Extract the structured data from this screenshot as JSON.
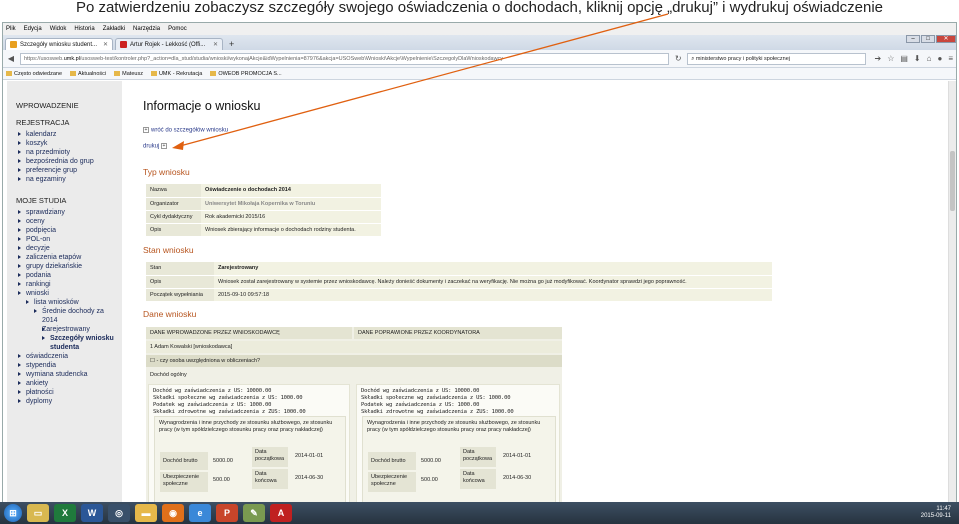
{
  "caption": "Po zatwierdzeniu zobaczysz szczegóły swojego oświadczenia o dochodach, kliknij opcję „drukuj” i wydrukuj oświadczenie",
  "menu": [
    "Plik",
    "Edycja",
    "Widok",
    "Historia",
    "Zakładki",
    "Narzędzia",
    "Pomoc"
  ],
  "tabs": [
    {
      "label": "Szczegóły wniosku student...",
      "color": "#e8a020",
      "active": true
    },
    {
      "label": "Artur Rojek - Lekkość (Offi...",
      "color": "#cc2020",
      "active": false
    }
  ],
  "newtab": "+",
  "url": {
    "prefix": "https://usosweb.",
    "host": "umk.pl",
    "rest": "/usosweb-test/kontroler.php?_action=dla_stud/studia/wnioski/wykonajAkcje&idWypelnienia=87976&akcja=USOSweb\\Wnioski\\Akcje\\Wypelnienie\\SzczegolyDlaWnioskodawcy"
  },
  "search": "ministerstwo pracy i polityki społecznej",
  "bookmarks": [
    "Często odwiedzane",
    "Aktualności",
    "Mateusz",
    "UMK - Rekrutacja",
    "OWEOB PROMOCJA S..."
  ],
  "sidebar": {
    "head1": "WPROWADZENIE",
    "head2": "REJESTRACJA",
    "reg": [
      "kalendarz",
      "koszyk",
      "na przedmioty",
      "bezpośrednia do grup",
      "preferencje grup",
      "na egzaminy"
    ],
    "head3": "MOJE STUDIA",
    "studia": [
      "sprawdziany",
      "oceny",
      "podpięcia",
      "POL-on",
      "decyzje",
      "zaliczenia etapów",
      "grupy dziekańskie",
      "podania",
      "rankingi",
      "wnioski"
    ],
    "wnioski_sub": "lista wniosków",
    "srednie": "Średnie dochody za",
    "year": "2014",
    "zarej": "Zarejestrowany",
    "szczegoly": "Szczegóły wniosku",
    "studenta": "studenta",
    "rest": [
      "oświadczenia",
      "stypendia",
      "wymiana studencka",
      "ankiety",
      "płatności",
      "dyplomy"
    ]
  },
  "main": {
    "title": "Informacje o wniosku",
    "back": "wróć do szczegółów wniosku",
    "print": "drukuj",
    "typ_header": "Typ wniosku",
    "typ_rows": [
      {
        "k": "Nazwa",
        "v": "Oświadczenie o dochodach 2014"
      },
      {
        "k": "Organizator",
        "v": "Uniwersytet Mikołaja Kopernika w Toruniu"
      },
      {
        "k": "Cykl dydaktyczny",
        "v": "Rok akademicki 2015/16"
      },
      {
        "k": "Opis",
        "v": "Wniosek zbierający informacje o dochodach rodziny studenta."
      }
    ],
    "stan_header": "Stan wniosku",
    "stan_rows": [
      {
        "k": "Stan",
        "v": "Zarejestrowany"
      },
      {
        "k": "Opis",
        "v": "Wniosek został zarejestrowany w systemie przez wnioskodawcę. Należy donieść dokumenty i zaczekać na weryfikację. Nie można go już modyfikować. Koordynator sprawdzi jego poprawność."
      },
      {
        "k": "Początek wypełniania",
        "v": "2015-09-10 09:57:18"
      }
    ],
    "dane_header": "Dane wniosku",
    "col_left": "DANE WPROWADZONE PRZEZ WNIOSKODAWCĘ",
    "col_right": "DANE POPRAWIONE PRZEZ KOORDYNATORA",
    "person": "1 Adam Kowalski [wnioskodawca]",
    "question": "- czy osoba uwzględniona w obliczeniach?",
    "dochod_ogolny": "Dochód ogólny",
    "lines": [
      "Dochód wg zaświadczenia z US: 10000.00",
      "Składki społeczne wg zaświadczenia z US: 1000.00",
      "Podatek wg zaświadczenia z US: 1000.00",
      "Składki zdrowotne wg zaświadczenia z ZUS: 1000.00"
    ],
    "wyn_text": "Wynagrodzenia i inne przychody ze stosunku służbowego, ze stosunku pracy (w tym spółdzielczego stosunku pracy oraz pracy nakładczej)",
    "dochod_brutto_k": "Dochód brutto",
    "dochod_brutto_v": "5000.00",
    "ubezp_k": "Ubezpieczenie społeczne",
    "ubezp_v": "500.00",
    "data_pocz_k": "Data początkowa",
    "data_pocz_v": "2014-01-01",
    "data_konc_k": "Data końcowa",
    "data_konc_v": "2014-06-30"
  },
  "taskbar": {
    "time": "11:47",
    "date": "2015-09-11"
  },
  "colors": {
    "accent": "#b7551f",
    "link": "#2a3a8a",
    "arrow": "#e06010"
  }
}
